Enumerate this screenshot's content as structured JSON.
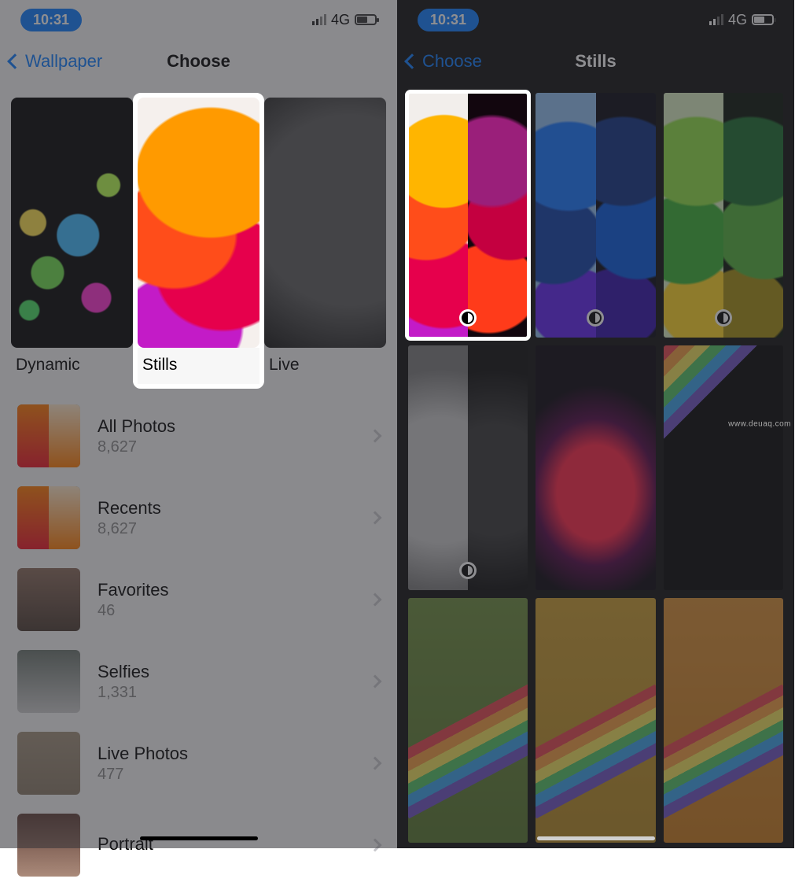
{
  "status": {
    "time": "10:31",
    "network_label": "4G"
  },
  "left": {
    "back_label": "Wallpaper",
    "title": "Choose",
    "categories": [
      {
        "id": "dynamic",
        "label": "Dynamic"
      },
      {
        "id": "stills",
        "label": "Stills"
      },
      {
        "id": "live",
        "label": "Live"
      }
    ],
    "albums": [
      {
        "id": "all",
        "title": "All Photos",
        "count": "8,627"
      },
      {
        "id": "recents",
        "title": "Recents",
        "count": "8,627"
      },
      {
        "id": "favorites",
        "title": "Favorites",
        "count": "46"
      },
      {
        "id": "selfies",
        "title": "Selfies",
        "count": "1,331"
      },
      {
        "id": "livep",
        "title": "Live Photos",
        "count": "477"
      },
      {
        "id": "portrait",
        "title": "Portrait",
        "count": ""
      }
    ]
  },
  "right": {
    "back_label": "Choose",
    "title": "Stills",
    "thumbnails": [
      {
        "id": "orange-split",
        "has_appearance_badge": true,
        "selected": true
      },
      {
        "id": "blue-split",
        "has_appearance_badge": true,
        "selected": false
      },
      {
        "id": "green-split",
        "has_appearance_badge": true,
        "selected": false
      },
      {
        "id": "bw-orb",
        "has_appearance_badge": true,
        "selected": false
      },
      {
        "id": "red-bloom",
        "has_appearance_badge": false,
        "selected": false
      },
      {
        "id": "rainbow-dark",
        "has_appearance_badge": false,
        "selected": false
      },
      {
        "id": "olive-stripe",
        "has_appearance_badge": false,
        "selected": false
      },
      {
        "id": "gold-stripe",
        "has_appearance_badge": false,
        "selected": false
      },
      {
        "id": "amber-stripe",
        "has_appearance_badge": false,
        "selected": false
      }
    ]
  },
  "watermark": "www.deuaq.com"
}
